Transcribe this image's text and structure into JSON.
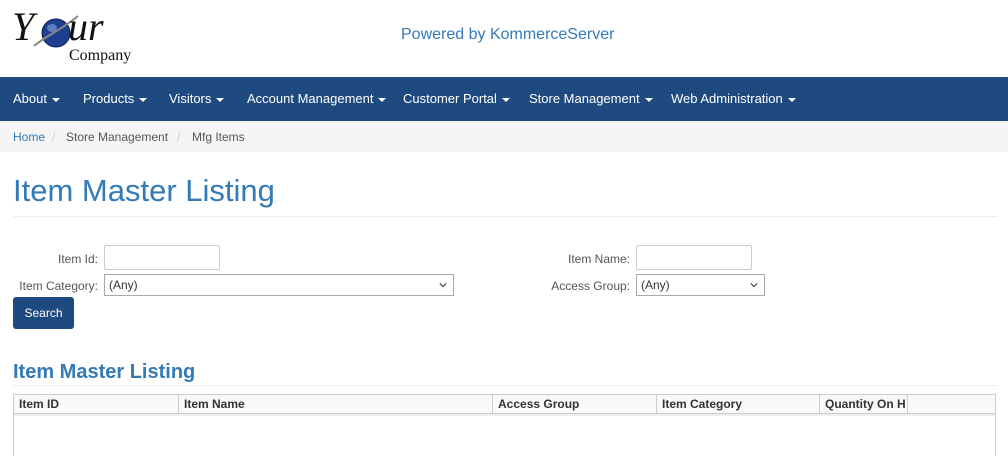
{
  "header": {
    "logo_word": "Your",
    "logo_sub": "Company",
    "powered_by": "Powered by KommerceServer"
  },
  "nav": {
    "items": [
      {
        "label": "About"
      },
      {
        "label": "Products"
      },
      {
        "label": "Visitors"
      },
      {
        "label": "Account Management"
      },
      {
        "label": "Customer Portal"
      },
      {
        "label": "Store Management"
      },
      {
        "label": "Web Administration"
      }
    ]
  },
  "breadcrumb": {
    "items": [
      "Home",
      "Store Management",
      "Mfg Items"
    ],
    "separator": "/"
  },
  "page": {
    "title": "Item Master Listing"
  },
  "form": {
    "item_id_label": "Item Id:",
    "item_id_value": "",
    "item_name_label": "Item Name:",
    "item_name_value": "",
    "item_category_label": "Item Category:",
    "item_category_value": "(Any)",
    "access_group_label": "Access Group:",
    "access_group_value": "(Any)",
    "search_button": "Search"
  },
  "listing": {
    "title": "Item Master Listing",
    "columns": [
      "Item ID",
      "Item Name",
      "Access Group",
      "Item Category",
      "Quantity On H"
    ]
  },
  "colors": {
    "navbar": "#1f4a80",
    "accent": "#337ab7",
    "button": "#1f4a80"
  },
  "icons": {
    "caret": "caret-down-icon",
    "select_chevron": "chevron-down-icon"
  }
}
